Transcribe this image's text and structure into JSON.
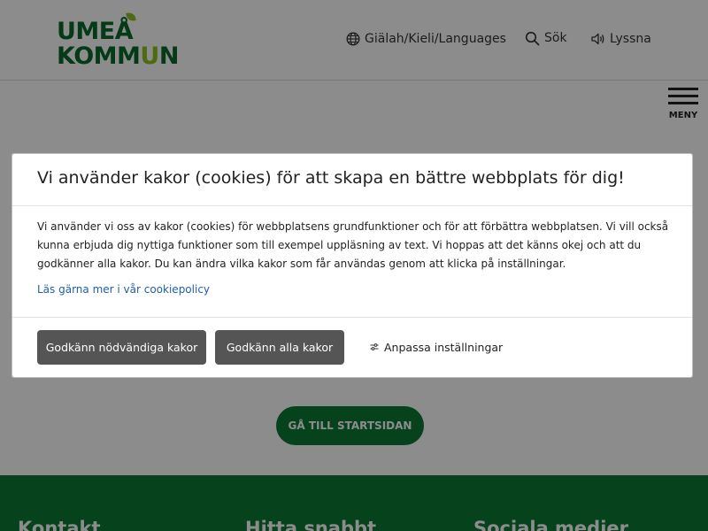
{
  "header": {
    "logo": {
      "line1": "UMEÅ",
      "line2_part1": "KOMM",
      "line2_accent": "U",
      "line2_part2": "N"
    },
    "nav": {
      "languages": "Giälah/Kieli/Languages",
      "search": "Sök",
      "listen": "Lyssna"
    },
    "menu_label": "MENY"
  },
  "main": {
    "start_button": "GÅ TILL STARTSIDAN"
  },
  "footer": {
    "headings": [
      "Kontakt",
      "Hitta snabbt",
      "Sociala medier"
    ]
  },
  "cookie_modal": {
    "title": "Vi använder kakor (cookies) för att skapa en bättre webbplats för dig!",
    "body": "Vi använder vi oss av kakor (cookies) för webbplatsens grundfunktioner och för att förbättra webbplatsen. Vi vill också kunna erbjuda dig nyttiga funktioner som till exempel uppläsning av text. Vi hoppas att det känns okej och att du godkänner alla kakor. Du kan ändra vilka kakor som får användas genom att klicka på inställningar.",
    "policy_link": "Läs gärna mer i vår cookiepolicy",
    "accept_necessary": "Godkänn nödvändiga kakor",
    "accept_all": "Godkänn alla kakor",
    "customize": "Anpassa inställningar"
  },
  "colors": {
    "brand_green": "#0c7a34",
    "logo_lime": "#8fc31f",
    "button_gray": "#555555",
    "link_blue": "#1f5fa8"
  },
  "icons": {
    "languages": "globe-icon",
    "search": "search-icon",
    "listen": "speaker-icon",
    "menu": "hamburger-icon",
    "customize": "settings-sliders-icon"
  }
}
